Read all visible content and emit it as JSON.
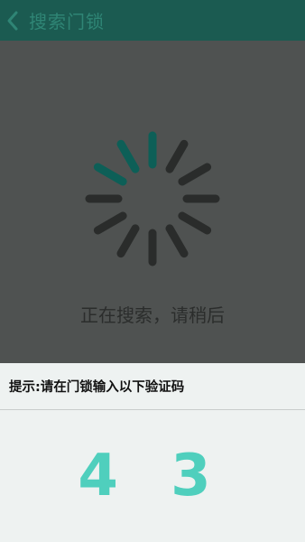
{
  "header": {
    "title": "搜索门锁"
  },
  "status": {
    "searching_text": "正在搜索，请稍后"
  },
  "hint": {
    "text": "提示:请在门锁输入以下验证码"
  },
  "verification": {
    "code": "4 3"
  },
  "colors": {
    "header_bg": "#1b5b51",
    "overlay_bg": "#4f5251",
    "code_color": "#4fcfbd",
    "spinner_active": "#0d5f57",
    "spinner_inactive": "#2a2c2b"
  }
}
